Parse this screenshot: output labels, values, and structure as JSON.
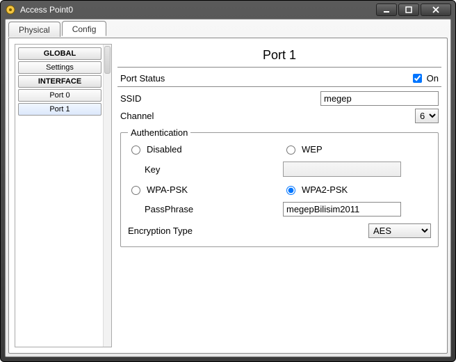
{
  "window": {
    "title": "Access Point0"
  },
  "tabs": {
    "physical": "Physical",
    "config": "Config",
    "active": "config"
  },
  "sidebar": {
    "global_header": "GLOBAL",
    "settings": "Settings",
    "interface_header": "INTERFACE",
    "port0": "Port 0",
    "port1": "Port 1"
  },
  "main": {
    "title": "Port 1",
    "port_status_label": "Port Status",
    "on_label": "On",
    "on_checked": true,
    "ssid_label": "SSID",
    "ssid_value": "megep",
    "channel_label": "Channel",
    "channel_value": "6",
    "auth": {
      "legend": "Authentication",
      "disabled": "Disabled",
      "wep": "WEP",
      "key_label": "Key",
      "key_value": "",
      "wpa_psk": "WPA-PSK",
      "wpa2_psk": "WPA2-PSK",
      "passphrase_label": "PassPhrase",
      "passphrase_value": "megepBilisim2011",
      "enc_label": "Encryption Type",
      "enc_value": "AES",
      "selected": "wpa2_psk"
    }
  }
}
